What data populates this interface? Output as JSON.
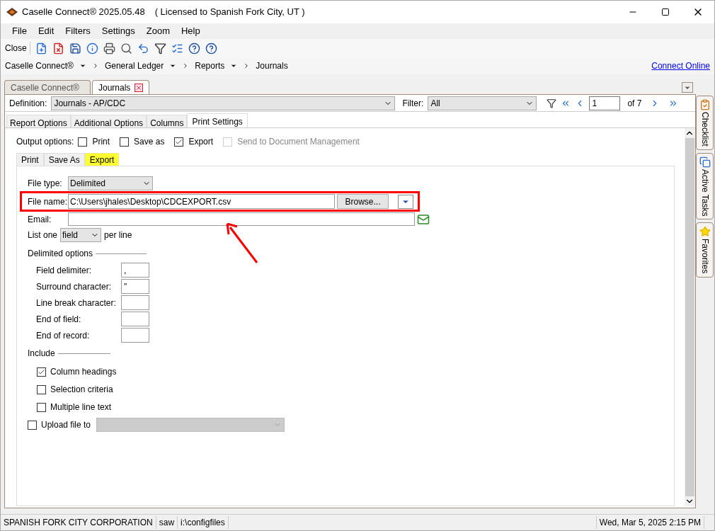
{
  "title_bar": {
    "app_title": "Caselle Connect® 2025.05.48",
    "license": "( Licensed to Spanish Fork City, UT )"
  },
  "menu": [
    "File",
    "Edit",
    "Filters",
    "Settings",
    "Zoom",
    "Help"
  ],
  "toolbar": {
    "close_label": "Close"
  },
  "breadcrumb": [
    {
      "label": "Caselle Connect®"
    },
    {
      "label": "General Ledger"
    },
    {
      "label": "Reports"
    },
    {
      "label": "Journals"
    }
  ],
  "connect_link": "Connect Online",
  "doc_tabs": [
    {
      "label": "Caselle Connect®",
      "selected": false,
      "closable": false
    },
    {
      "label": "Journals",
      "selected": true,
      "closable": true
    }
  ],
  "definition": {
    "label": "Definition:",
    "value": "Journals - AP/CDC"
  },
  "filter": {
    "label": "Filter:",
    "value": "All"
  },
  "pager": {
    "page": "1",
    "of": "of 7"
  },
  "report_tabs": [
    {
      "label": "Report Options",
      "selected": false
    },
    {
      "label": "Additional Options",
      "selected": false
    },
    {
      "label": "Columns",
      "selected": false
    },
    {
      "label": "Print Settings",
      "selected": true
    }
  ],
  "output_options": {
    "label": "Output options:",
    "options": [
      {
        "label": "Print",
        "checked": false,
        "disabled": false
      },
      {
        "label": "Save as",
        "checked": false,
        "disabled": false
      },
      {
        "label": "Export",
        "checked": true,
        "disabled": false
      },
      {
        "label": "Send to Document Management",
        "checked": false,
        "disabled": true
      }
    ]
  },
  "output_tabs": [
    {
      "label": "Print",
      "selected": false
    },
    {
      "label": "Save As",
      "selected": false
    },
    {
      "label": "Export",
      "selected": true
    }
  ],
  "export": {
    "file_type": {
      "label": "File type:",
      "value": "Delimited"
    },
    "file_name": {
      "label": "File name:",
      "value": "C:\\Users\\jhales\\Desktop\\CDCEXPORT.csv",
      "browse": "Browse..."
    },
    "email": {
      "label": "Email:"
    },
    "list_one": {
      "label": "List one",
      "value": "field",
      "suffix": "per line"
    },
    "delimited": {
      "title": "Delimited options",
      "fields": [
        {
          "label": "Field delimiter:",
          "value": ","
        },
        {
          "label": "Surround character:",
          "value": "\""
        },
        {
          "label": "Line break character:"
        },
        {
          "label": "End of field:"
        },
        {
          "label": "End of record:"
        }
      ]
    },
    "include": {
      "title": "Include",
      "items": [
        {
          "label": "Column headings",
          "checked": true
        },
        {
          "label": "Selection criteria",
          "checked": false
        },
        {
          "label": "Multiple line text",
          "checked": false
        }
      ]
    },
    "upload": {
      "label": "Upload file to",
      "checked": false
    }
  },
  "side_tabs": [
    {
      "label": "Checklist",
      "kind": "checklist"
    },
    {
      "label": "Active Tasks",
      "kind": "tasks"
    },
    {
      "label": "Favorites",
      "kind": "favorites"
    }
  ],
  "status_bar": [
    "SPANISH FORK CITY CORPORATION",
    "saw",
    "i:\\configfiles",
    "Wed, Mar 5, 2025 2:15 PM"
  ]
}
